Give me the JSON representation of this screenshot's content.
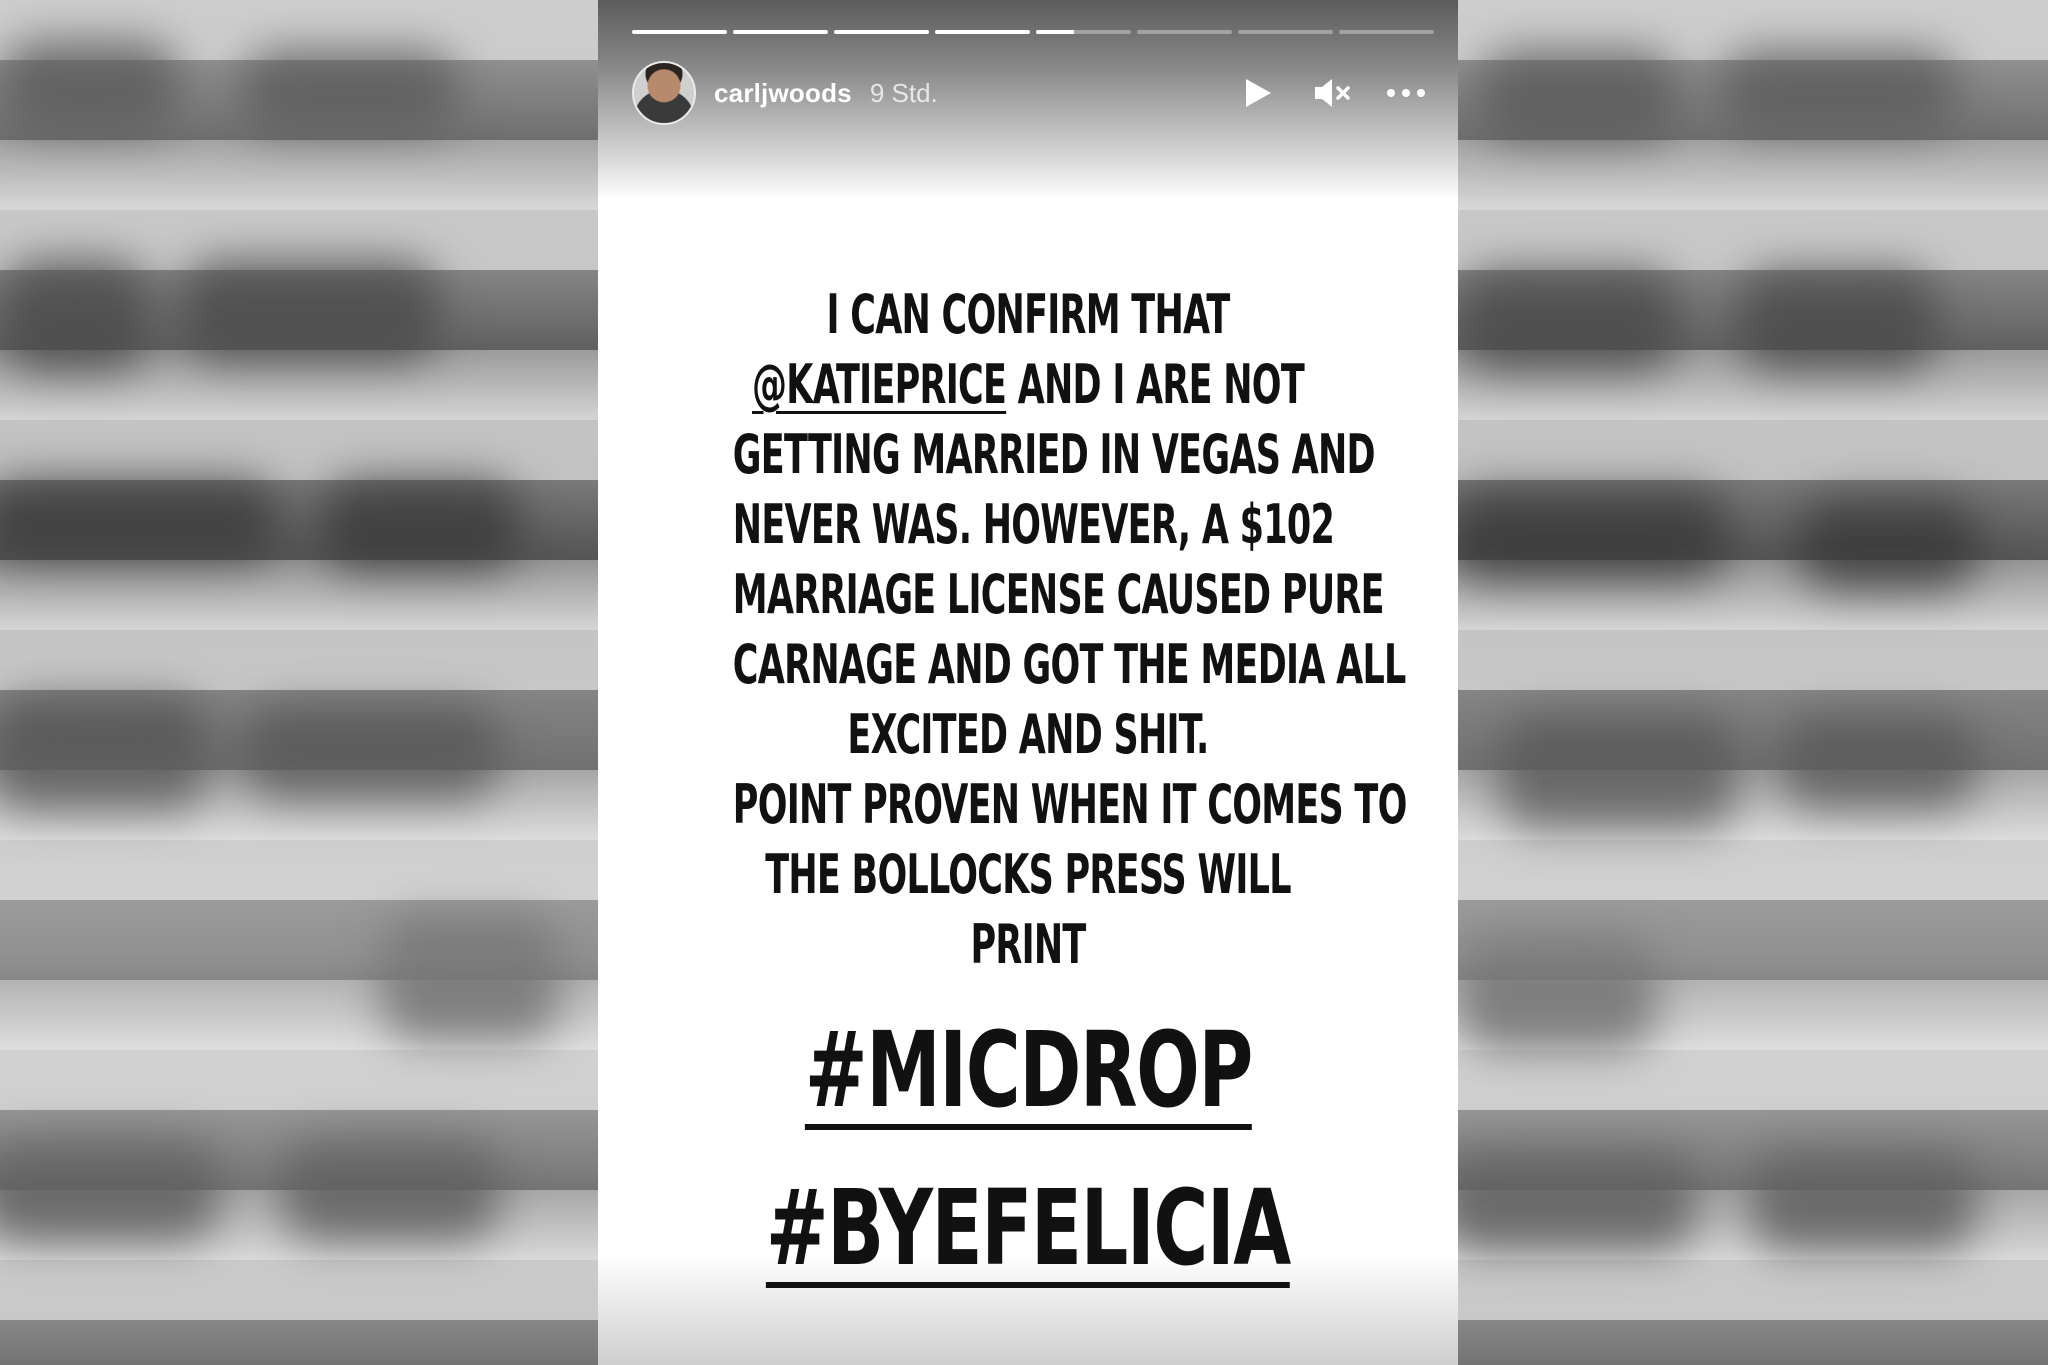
{
  "story": {
    "progress_segments": [
      1,
      1,
      1,
      1,
      0.4,
      0,
      0,
      0
    ],
    "header": {
      "username": "carljwoods",
      "timestamp": "9 Std.",
      "controls": [
        {
          "name": "play",
          "icon": "play-icon"
        },
        {
          "name": "mute",
          "icon": "speaker-muted-icon"
        },
        {
          "name": "more",
          "icon": "more-dots-icon"
        }
      ]
    },
    "text_lines": [
      "I CAN CONFIRM THAT",
      "@KATIEPRICE",
      " AND I ARE NOT",
      "GETTING MARRIED IN VEGAS AND",
      "NEVER WAS. HOWEVER, A $102",
      "MARRIAGE LICENSE CAUSED PURE",
      "CARNAGE AND GOT THE MEDIA ALL",
      "EXCITED AND SHIT.",
      "POINT PROVEN WHEN IT COMES TO",
      "THE BOLLOCKS PRESS WILL",
      "PRINT"
    ],
    "hashtags": [
      "#MICDROP",
      "#BYEFELICIA"
    ],
    "colors": {
      "text": "#111111",
      "card_background": "#ffffff",
      "progress_active": "#ffffff"
    }
  }
}
